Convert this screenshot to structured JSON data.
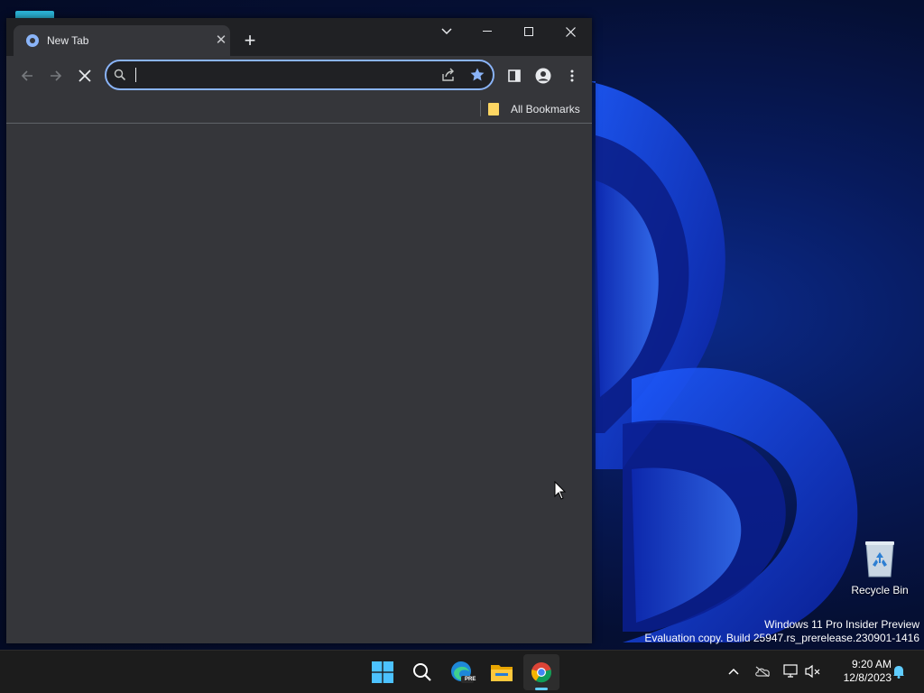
{
  "browser": {
    "tab_title": "New Tab",
    "address_value": "",
    "bookmarks": {
      "all_bookmarks_label": "All Bookmarks"
    }
  },
  "desktop": {
    "recycle_bin_label": "Recycle Bin",
    "watermark_line1": "Windows 11 Pro Insider Preview",
    "watermark_line2": "Evaluation copy. Build 25947.rs_prerelease.230901-1416"
  },
  "taskbar": {
    "clock_time": "9:20 AM",
    "clock_date": "12/8/2023",
    "edge_badge": "PRE"
  },
  "colors": {
    "accent": "#8ab4f8",
    "chrome_bg": "#35363a",
    "titlebar_bg": "#202124",
    "taskbar_bg": "#1c1c1c",
    "indicator": "#60cdff"
  }
}
